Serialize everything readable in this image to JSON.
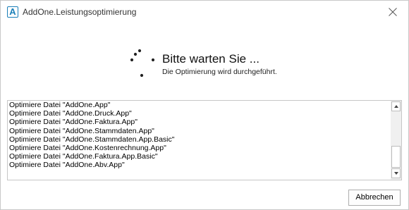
{
  "window": {
    "title": "AddOne.Leistungsoptimierung",
    "icon": "addone-app-icon",
    "accent_color": "#1a7fb8"
  },
  "status": {
    "heading": "Bitte warten Sie ...",
    "subtext": "Die Optimierung wird durchgeführt."
  },
  "log": {
    "lines": [
      "Optimiere Datei \"AddOne.App\"",
      "Optimiere Datei \"AddOne.Druck.App\"",
      "Optimiere Datei \"AddOne.Faktura.App\"",
      "Optimiere Datei \"AddOne.Stammdaten.App\"",
      "Optimiere Datei \"AddOne.Stammdaten.App.Basic\"",
      "Optimiere Datei \"AddOne.Kostenrechnung.App\"",
      "Optimiere Datei \"AddOne.Faktura.App.Basic\"",
      "Optimiere Datei \"AddOne.Abv.App\""
    ]
  },
  "buttons": {
    "cancel_label": "Abbrechen"
  }
}
